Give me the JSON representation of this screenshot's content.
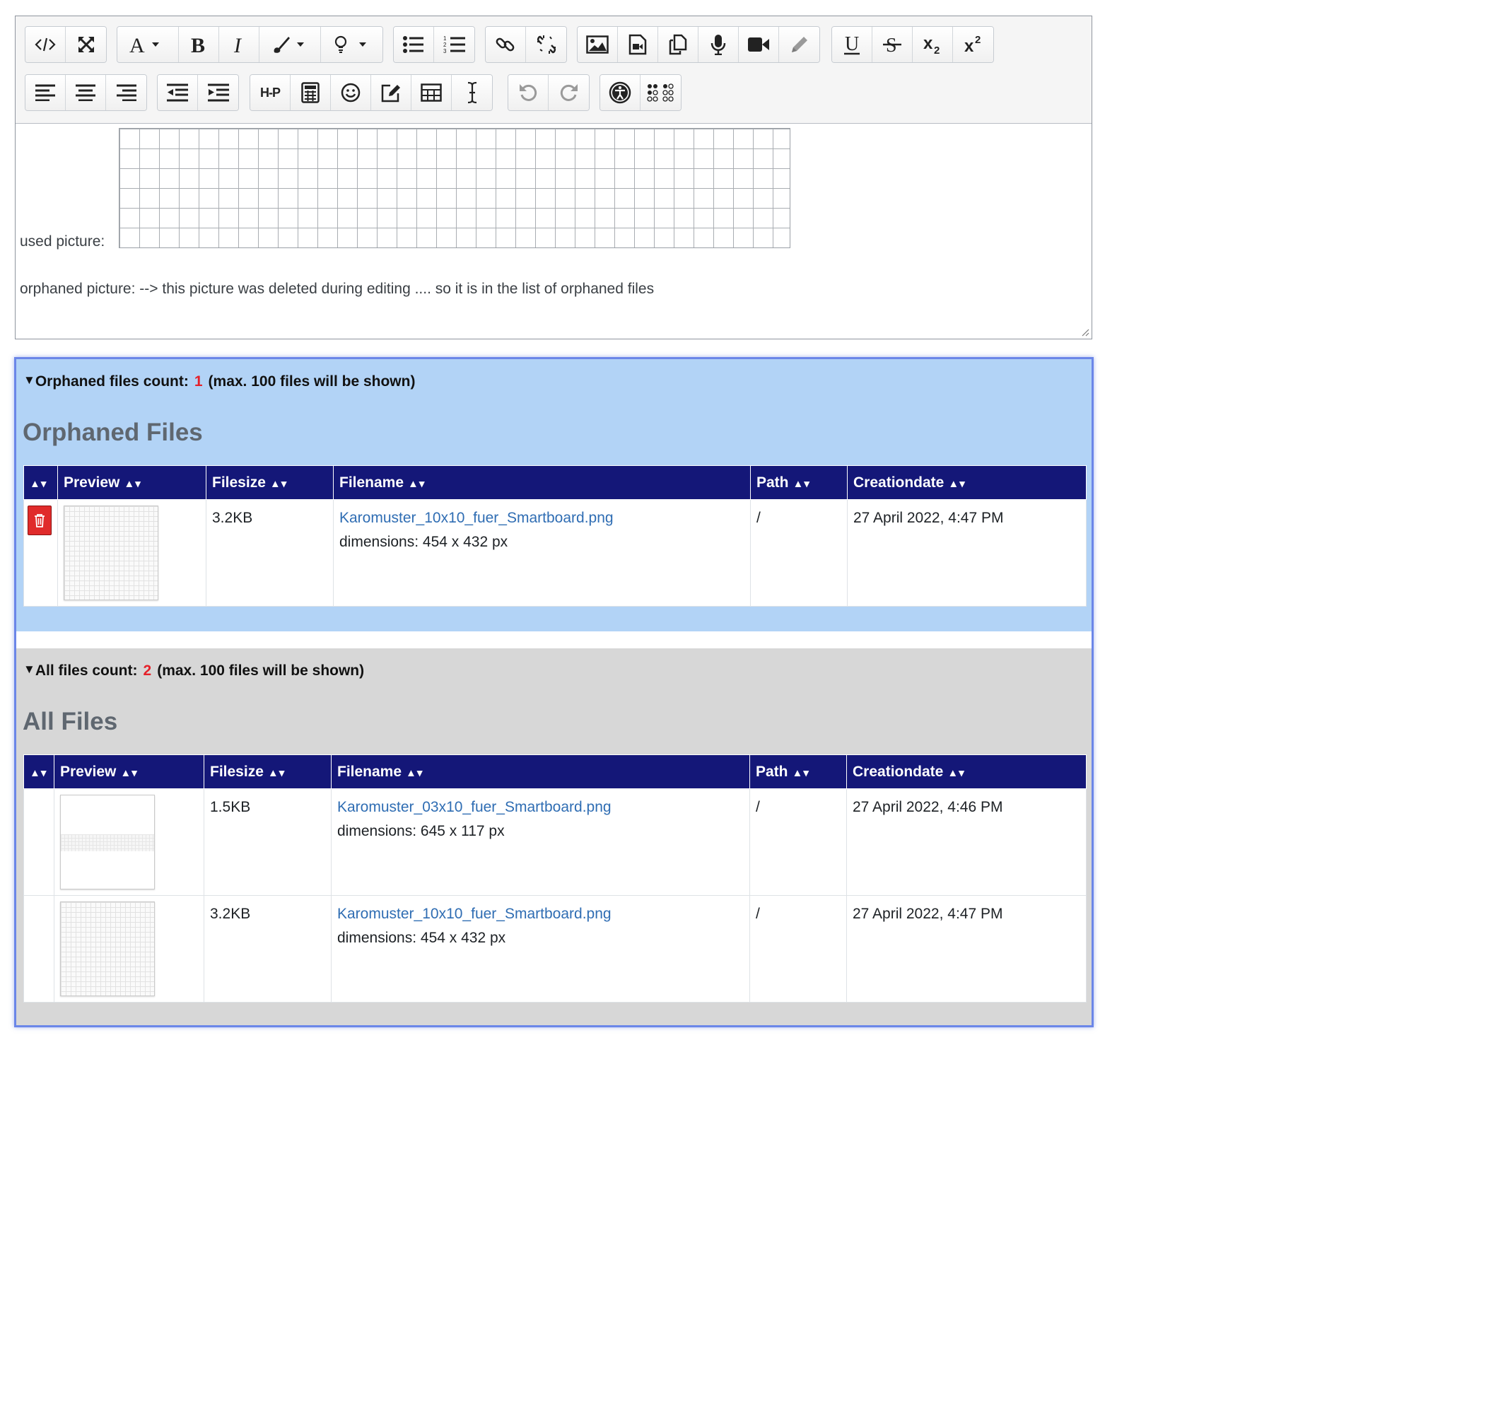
{
  "editor": {
    "toolbar_row1": [
      "html-icon",
      "fullscreen-icon",
      "font-color-icon",
      "bold-icon",
      "italic-icon",
      "brush-icon",
      "lightbulb-icon",
      "bullet-list-icon",
      "numbered-list-icon",
      "link-icon",
      "unlink-icon",
      "image-icon",
      "media-icon",
      "files-icon",
      "microphone-icon",
      "video-icon",
      "pencil-icon",
      "underline-icon",
      "strikethrough-icon",
      "subscript-icon",
      "superscript-icon"
    ],
    "toolbar_row2": [
      "align-left-icon",
      "align-center-icon",
      "align-right-icon",
      "outdent-icon",
      "indent-icon",
      "h5p-icon",
      "calculator-icon",
      "emoji-icon",
      "edit-icon",
      "table-icon",
      "text-cursor-icon",
      "undo-icon",
      "redo-icon",
      "accessibility-icon",
      "braille-icon"
    ],
    "h5p_label": "H-P",
    "used_picture_label": "used picture:",
    "orphaned_picture_text": "orphaned picture: --> this picture was deleted during editing .... so it is in the list of orphaned files"
  },
  "orphaned": {
    "summary_label": "Orphaned files count:",
    "count": "1",
    "summary_suffix": "(max.  100 files will be shown)",
    "title": "Orphaned Files",
    "columns": [
      "",
      "Preview",
      "Filesize",
      "Filename",
      "Path",
      "Creationdate"
    ],
    "rows": [
      {
        "filesize": "3.2KB",
        "filename": "Karomuster_10x10_fuer_Smartboard.png",
        "dimensions": "dimensions: 454 x 432 px",
        "path": "/",
        "creationdate": "27 April 2022, 4:47 PM"
      }
    ]
  },
  "all": {
    "summary_label": "All files count:",
    "count": "2",
    "summary_suffix": "(max.  100 files will be shown)",
    "title": "All Files",
    "columns": [
      "",
      "Preview",
      "Filesize",
      "Filename",
      "Path",
      "Creationdate"
    ],
    "rows": [
      {
        "filesize": "1.5KB",
        "filename": "Karomuster_03x10_fuer_Smartboard.png",
        "dimensions": "dimensions: 645 x 117 px",
        "path": "/",
        "creationdate": "27 April 2022, 4:46 PM"
      },
      {
        "filesize": "3.2KB",
        "filename": "Karomuster_10x10_fuer_Smartboard.png",
        "dimensions": "dimensions: 454 x 432 px",
        "path": "/",
        "creationdate": "27 April 2022, 4:47 PM"
      }
    ]
  },
  "sort_arrows": "▲▾",
  "colors": {
    "header_bg": "#141778",
    "orphan_bg": "#b2d3f6",
    "all_bg": "#d7d7d7",
    "count_red": "#e5212a",
    "link_blue": "#2f6db3",
    "delete_red": "#e02b2b"
  }
}
